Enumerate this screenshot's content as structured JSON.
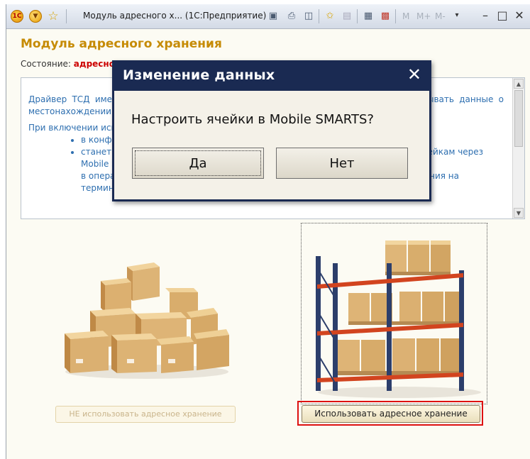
{
  "titlebar": {
    "title": "Модуль адресного х...  (1С:Предприятие)",
    "m_labels": [
      "M",
      "M+",
      "M-"
    ]
  },
  "heading": "Модуль адресного хранения",
  "state": {
    "label": "Состояние:",
    "value": "адресно"
  },
  "description": {
    "para1": "Драйвер ТСД имеет Модуль адресного хранения. Он позволяет хранить и обрабатывать данные о местонахождении товара в ячейках адресного хранения.",
    "para2": "При включении использования адресного хранения появятся возможности:",
    "items": [
      "в конфигурации появится возможность ведения учета по \"ячейкам\";",
      "станет доступна операция (размещение, отбор, перемещение) товара по ячейкам через Mobile SMARTS;",
      "в операциях \"Подбор заказа\" станет доступна возможность выгружать задания на терминал с указанием конкретных мест хранения товара на складе;"
    ]
  },
  "buttons": {
    "not_use": "НЕ использовать адресное хранение",
    "use": "Использовать адресное хранение"
  },
  "dialog": {
    "title": "Изменение данных",
    "question": "Настроить ячейки в Mobile SMARTS?",
    "yes": "Да",
    "no": "Нет"
  },
  "colors": {
    "heading": "#c68b05",
    "state_value": "#cc0000",
    "description_text": "#2e6fb0",
    "dialog_title_bar": "#1a2a52",
    "highlight": "#dd1111"
  }
}
